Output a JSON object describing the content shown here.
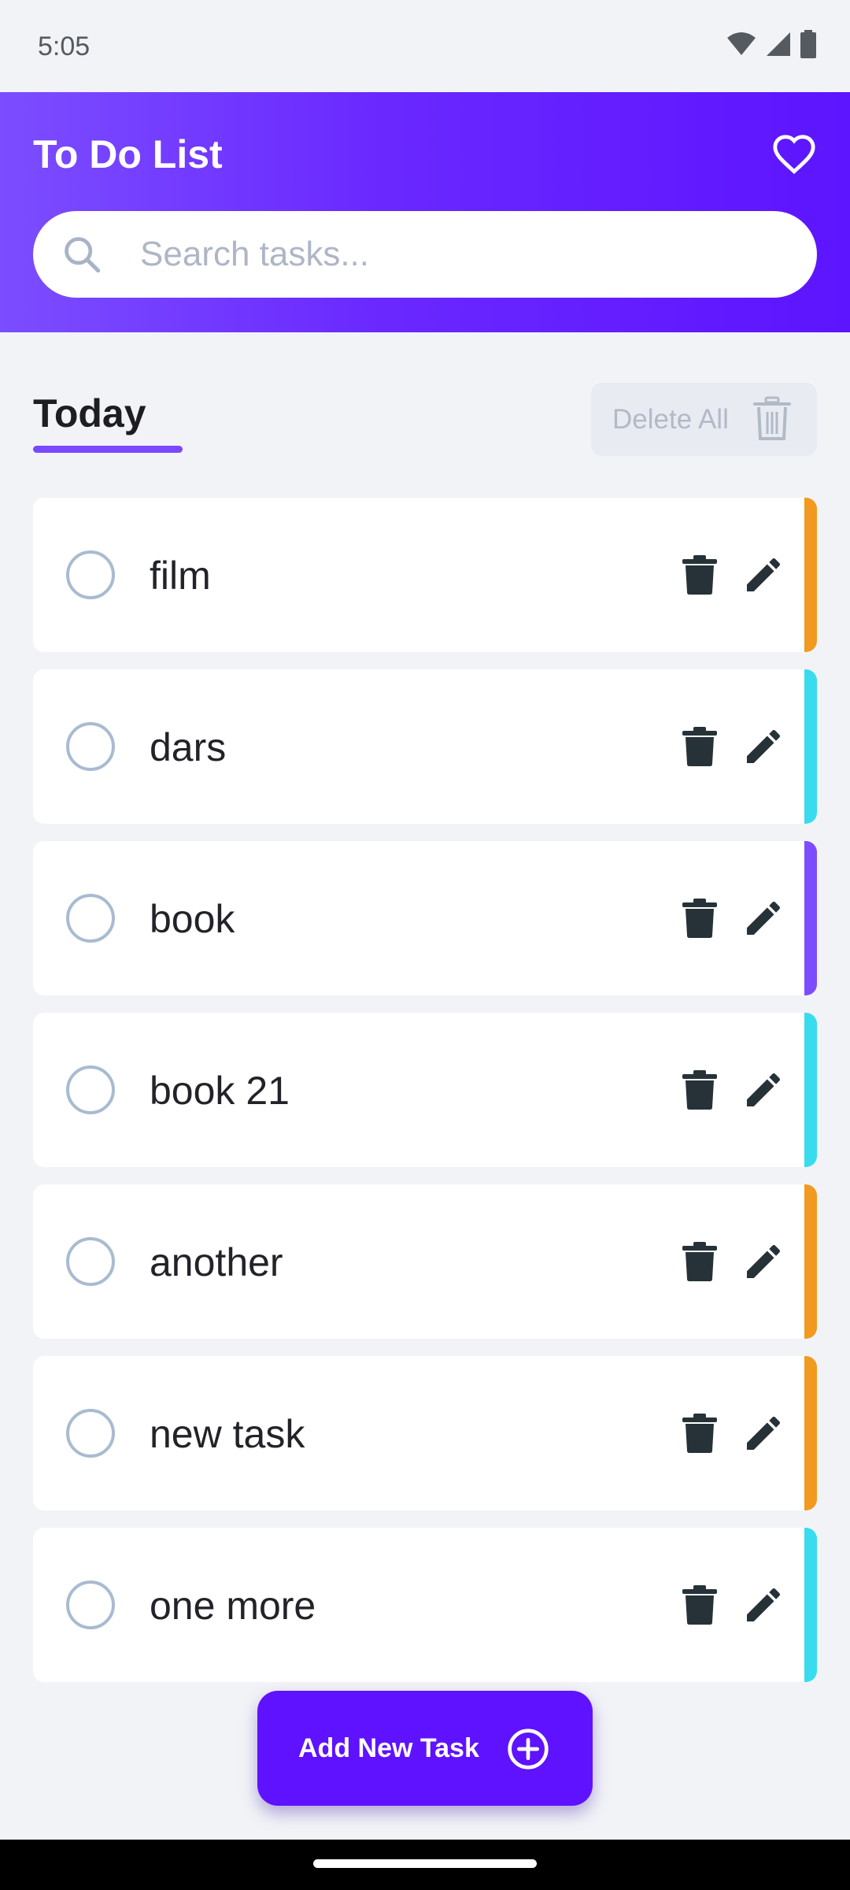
{
  "status": {
    "time": "5:05"
  },
  "header": {
    "title": "To Do List",
    "search_placeholder": "Search tasks..."
  },
  "section": {
    "tab": "Today",
    "delete_all_label": "Delete All"
  },
  "tasks": [
    {
      "label": "film",
      "accent": "#f29a1f"
    },
    {
      "label": "dars",
      "accent": "#38dcee"
    },
    {
      "label": "book",
      "accent": "#7b4dff"
    },
    {
      "label": "book 21",
      "accent": "#38dcee"
    },
    {
      "label": "another",
      "accent": "#f29a1f"
    },
    {
      "label": "new task",
      "accent": "#f29a1f"
    },
    {
      "label": "one more",
      "accent": "#38dcee"
    }
  ],
  "actions": {
    "add_task_label": "Add New Task"
  },
  "colors": {
    "primary": "#5f12ff",
    "background": "#f2f3f7"
  }
}
